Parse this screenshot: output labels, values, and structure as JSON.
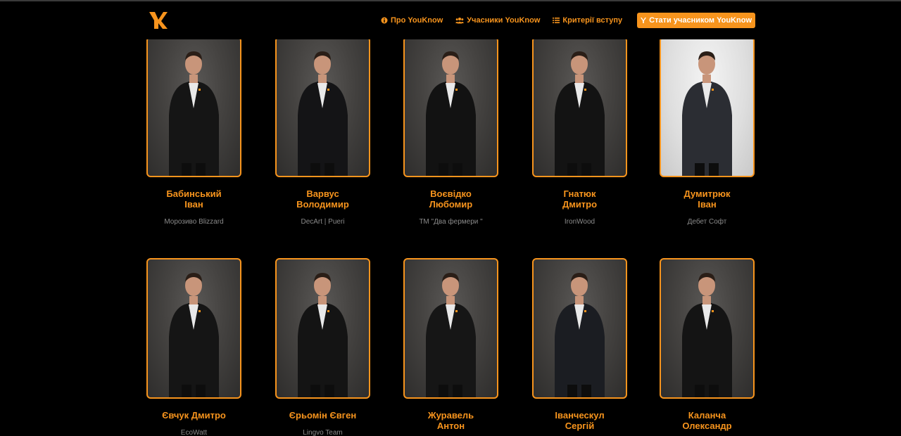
{
  "header": {
    "logo_text": "YK",
    "nav": [
      {
        "label": "Про YouKnow",
        "icon": "info-icon"
      },
      {
        "label": "Учасники YouKnow",
        "icon": "users-icon"
      },
      {
        "label": "Критерії вступу",
        "icon": "list-icon"
      }
    ],
    "cta": {
      "label": "Стати учасником YouKnow",
      "icon": "youknow-y-icon"
    }
  },
  "colors": {
    "accent": "#f7941d",
    "background": "#000000",
    "muted": "#8a8a8a"
  },
  "members": [
    {
      "name_line1": "Бабинський",
      "name_line2": "Іван",
      "company": "Морозиво Blizzard"
    },
    {
      "name_line1": "Варвус",
      "name_line2": "Володимир",
      "company": "DecArt | Pueri"
    },
    {
      "name_line1": "Воєвідко",
      "name_line2": "Любомир",
      "company": "ТМ \"Два фермери \""
    },
    {
      "name_line1": "Гнатюк",
      "name_line2": "Дмитро",
      "company": "IronWood"
    },
    {
      "name_line1": "Думитрюк",
      "name_line2": "Іван",
      "company": "Дебет Софт"
    },
    {
      "name_line1": "Євчук Дмитро",
      "name_line2": "",
      "company": "EcoWatt"
    },
    {
      "name_line1": "Єрьомін Євген",
      "name_line2": "",
      "company": "Lingvo Team"
    },
    {
      "name_line1": "Журавель",
      "name_line2": "Антон",
      "company": ""
    },
    {
      "name_line1": "Іванческул",
      "name_line2": "Сергій",
      "company": ""
    },
    {
      "name_line1": "Каланча",
      "name_line2": "Олександр",
      "company": ""
    }
  ]
}
